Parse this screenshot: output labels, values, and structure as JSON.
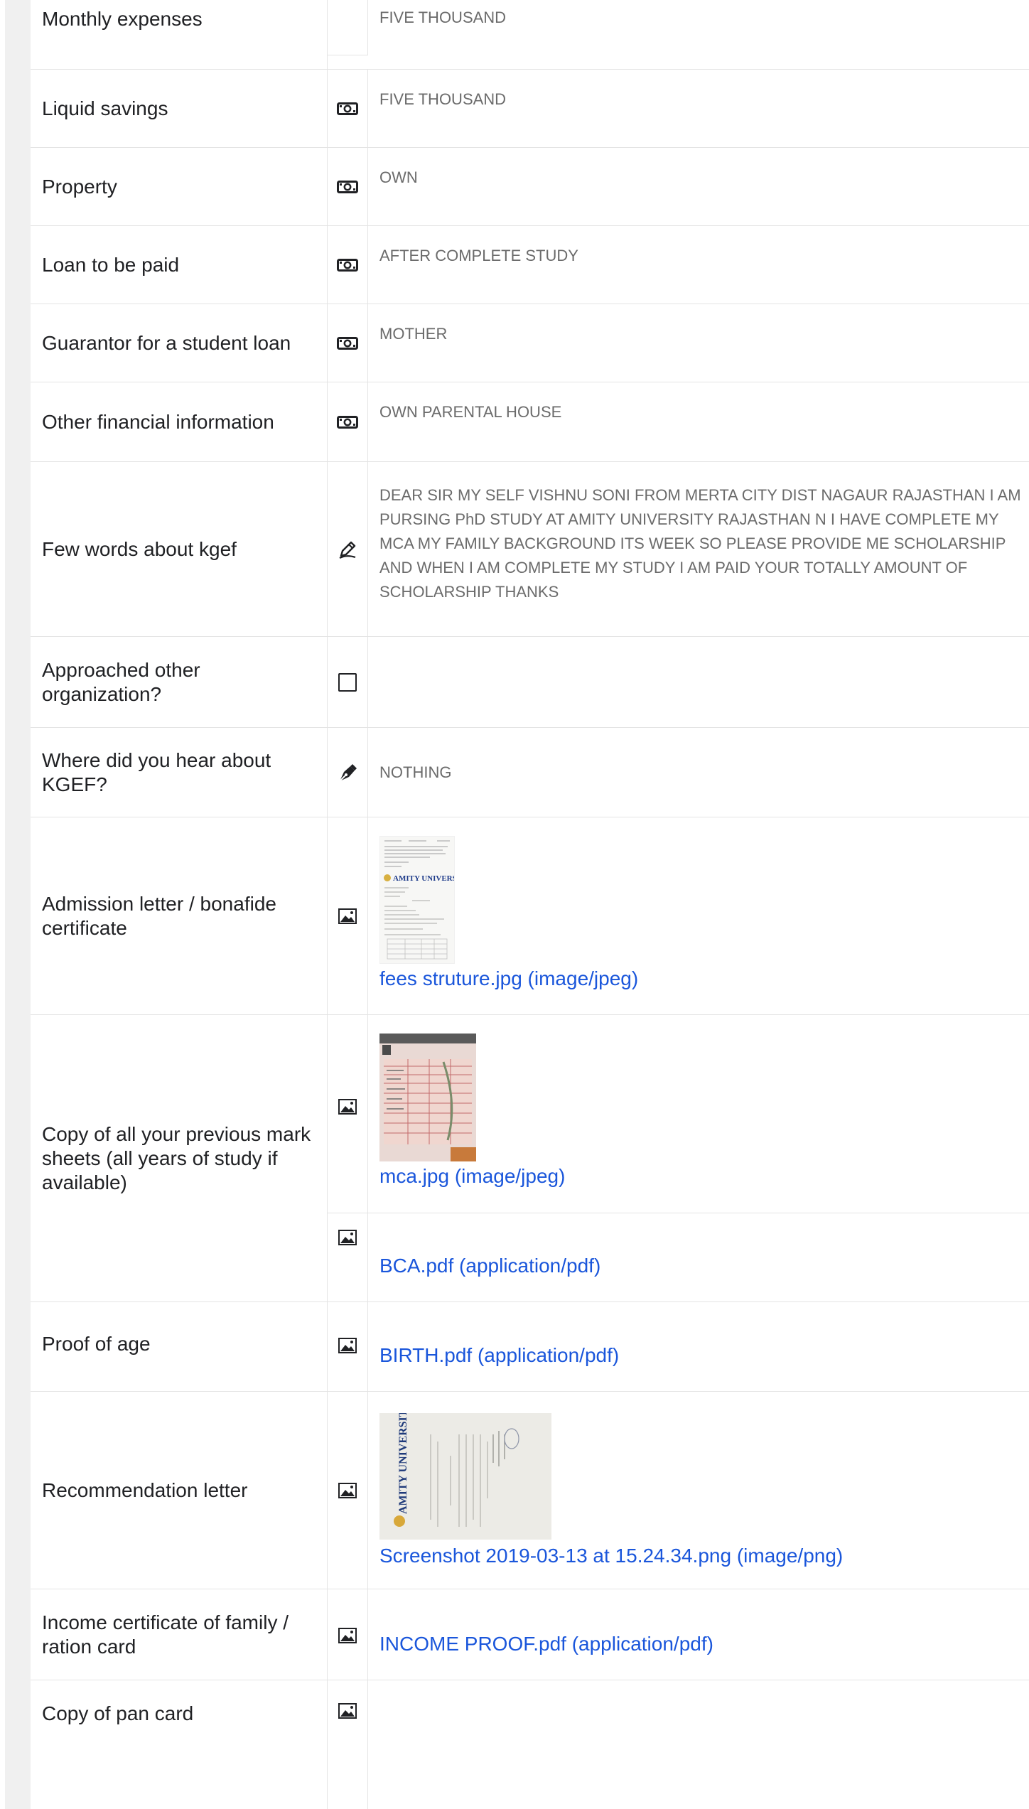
{
  "rows": {
    "monthly_expenses": {
      "label": "Monthly expenses",
      "value": "FIVE THOUSAND"
    },
    "liquid_savings": {
      "label": "Liquid savings",
      "value": "FIVE THOUSAND",
      "icon": "money-icon"
    },
    "property": {
      "label": "Property",
      "value": "OWN",
      "icon": "money-icon"
    },
    "loan_to_be_paid": {
      "label": "Loan to be paid",
      "value": "AFTER COMPLETE STUDY",
      "icon": "money-icon"
    },
    "guarantor": {
      "label": "Guarantor for a student loan",
      "value": "MOTHER",
      "icon": "money-icon"
    },
    "other_financial": {
      "label": "Other financial information",
      "value": "OWN PARENTAL HOUSE",
      "icon": "money-icon"
    },
    "few_words": {
      "label": "Few words about kgef",
      "icon": "pen-icon",
      "lines": [
        "DEAR SIR MY SELF VISHNU SONI FROM MERTA CITY DIST NAGAUR RAJASTHAN I AM",
        "PURSING PhD STUDY AT AMITY UNIVERSITY RAJASTHAN N I HAVE COMPLETE MY",
        "MCA MY FAMILY BACKGROUND ITS WEEK SO PLEASE PROVIDE ME SCHOLARSHIP",
        "AND WHEN I AM COMPLETE MY STUDY I AM PAID YOUR TOTALLY AMOUNT OF",
        "SCHOLARSHIP THANKS"
      ]
    },
    "approached_other": {
      "label_lines": [
        "Approached other",
        "organization?"
      ],
      "icon": "checkbox-icon",
      "value": ""
    },
    "where_hear": {
      "label_lines": [
        "Where did you hear about",
        "KGEF?"
      ],
      "value": "NOTHING",
      "icon": "fountain-pen-icon"
    },
    "admission_letter": {
      "label_lines": [
        "Admission letter / bonafide",
        "certificate"
      ],
      "icon": "image-icon",
      "attachment": "fees struture.jpg (image/jpeg)",
      "thumb_text": "AMITY UNIVERSITY"
    },
    "mark_sheets": {
      "label_lines": [
        "Copy of all your previous mark",
        "sheets (all years of study if",
        "available)"
      ],
      "icon": "image-icon",
      "attachments": [
        "mca.jpg (image/jpeg)",
        "BCA.pdf (application/pdf)"
      ]
    },
    "proof_of_age": {
      "label": "Proof of age",
      "icon": "image-icon",
      "attachment": "BIRTH.pdf (application/pdf)"
    },
    "recommendation": {
      "label": "Recommendation letter",
      "icon": "image-icon",
      "attachment": "Screenshot 2019-03-13 at 15.24.34.png (image/png)",
      "thumb_text": "AMITY UNIVERSITY"
    },
    "income_certificate": {
      "label_lines": [
        "Income certificate of family /",
        "ration card"
      ],
      "icon": "image-icon",
      "attachment": "INCOME PROOF.pdf (application/pdf)"
    },
    "pan_card": {
      "label": "Copy of pan card",
      "icon": "image-icon"
    }
  },
  "colors": {
    "link": "#1a56db",
    "value_text": "#6b6b6b",
    "label_text": "#202124",
    "border": "#e4e4e4",
    "gutter": "#f0f0f0"
  }
}
